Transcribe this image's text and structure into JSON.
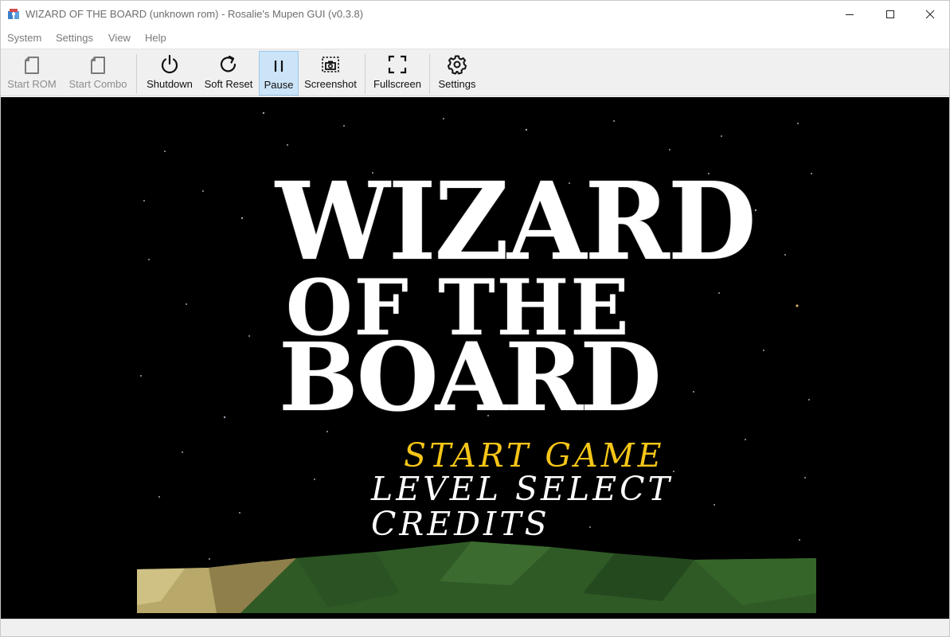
{
  "window": {
    "title": "WIZARD OF THE BOARD (unknown rom) - Rosalie's Mupen GUI (v0.3.8)"
  },
  "window_controls": {
    "minimize_icon": "minimize-icon",
    "maximize_icon": "maximize-icon",
    "close_icon": "close-icon"
  },
  "menu": {
    "items": [
      "System",
      "Settings",
      "View",
      "Help"
    ]
  },
  "toolbar": {
    "buttons": [
      {
        "label": "Start ROM",
        "icon": "document-icon",
        "enabled": false
      },
      {
        "label": "Start Combo",
        "icon": "document-icon",
        "enabled": false
      },
      {
        "label": "Shutdown",
        "icon": "power-icon",
        "enabled": true
      },
      {
        "label": "Soft Reset",
        "icon": "refresh-icon",
        "enabled": true
      },
      {
        "label": "Pause",
        "icon": "pause-icon",
        "enabled": true,
        "active": true
      },
      {
        "label": "Screenshot",
        "icon": "camera-icon",
        "enabled": true
      },
      {
        "label": "Fullscreen",
        "icon": "fullscreen-icon",
        "enabled": true
      },
      {
        "label": "Settings",
        "icon": "gear-icon",
        "enabled": true
      }
    ]
  },
  "game": {
    "logo": [
      "WIZARD",
      "OF THE",
      "BOARD"
    ],
    "menu_options": [
      "START GAME",
      "LEVEL SELECT",
      "CREDITS"
    ],
    "selected_option": "START GAME",
    "colors": {
      "selected": "#f5c518",
      "unselected": "#ffffff",
      "background": "#000000",
      "grass": "#2f5a26",
      "sand": "#b8a86a"
    }
  }
}
